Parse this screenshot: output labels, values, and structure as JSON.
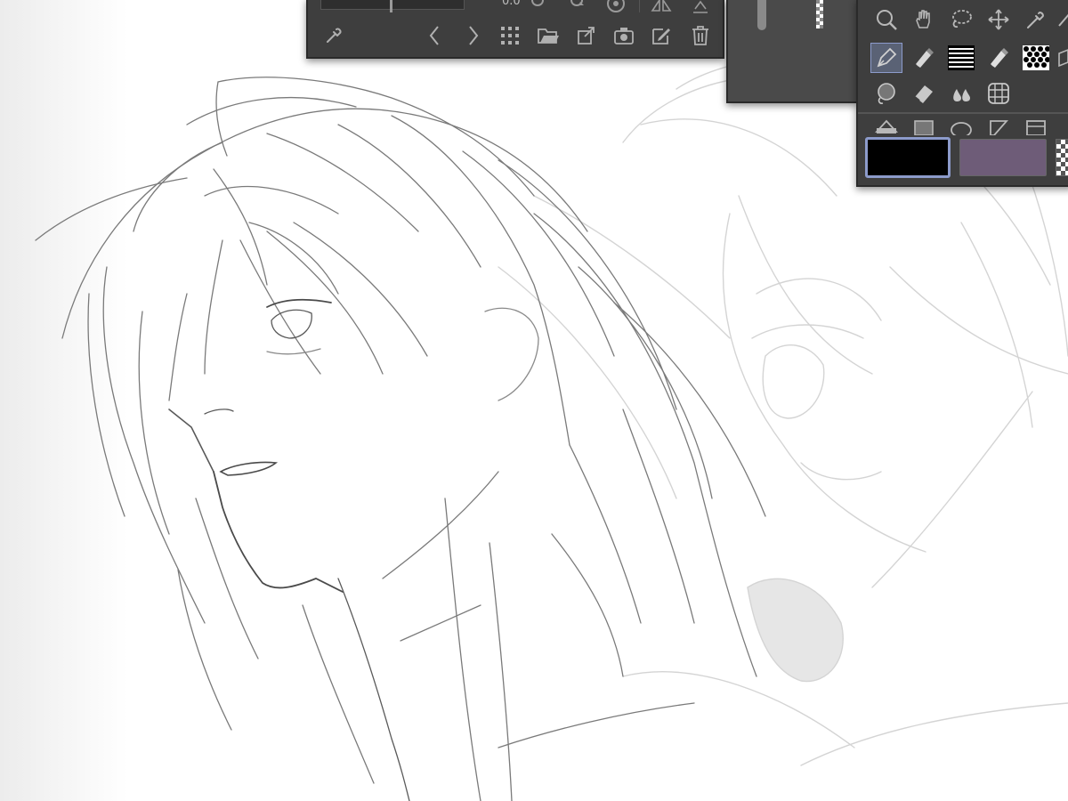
{
  "canvas": {
    "background": "#ffffff",
    "sketch_stroke": "#5a5a5a"
  },
  "navigator_panel": {
    "angle_readout": "0.0",
    "icons": [
      "eyedropper-icon",
      "chevron-left-icon",
      "chevron-right-icon",
      "grid-icon",
      "open-folder-icon",
      "export-icon",
      "camera-icon",
      "edit-note-icon",
      "trash-icon",
      "rotate-left-icon",
      "rotate-right-icon",
      "reset-rotation-icon",
      "flip-horizontal-icon",
      "flip-vertical-icon"
    ]
  },
  "opacity_panel": {
    "track_color": "#8a8a8a"
  },
  "tool_palette": {
    "rows": [
      [
        "zoom-icon",
        "hand-icon",
        "lasso-icon",
        "move-icon",
        "eyedropper-icon"
      ],
      [
        "pen-icon",
        "marker-icon",
        "hatching-icon",
        "brush-icon",
        "screentone-icon"
      ],
      [
        "blend-icon",
        "eraser-icon",
        "fill-icon",
        "grid-ruler-icon"
      ],
      [
        "gradient-icon",
        "shape-icon",
        "ellipse-icon",
        "ruler-icon",
        "frame-icon"
      ]
    ],
    "active_tool": "pen-icon"
  },
  "colors": {
    "main": "#000000",
    "sub": "#6e5c78",
    "panel_bg": "#3e3e3e",
    "accent_border": "#8c9bcb"
  }
}
